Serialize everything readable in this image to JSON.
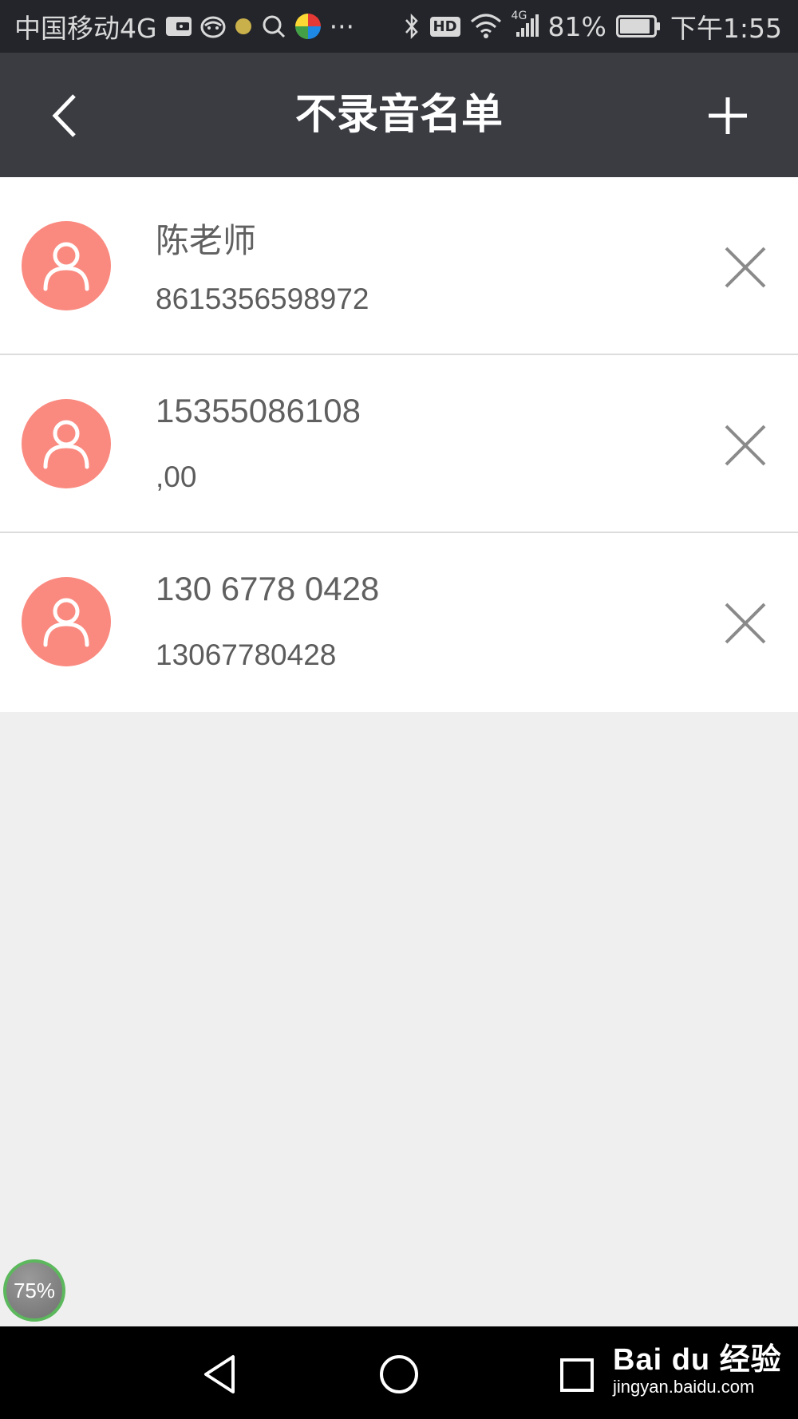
{
  "status_bar": {
    "carrier": "中国移动4G",
    "battery_percent": "81%",
    "time": "下午1:55",
    "network_label": "4G",
    "hd_label": "HD",
    "more_label": "···"
  },
  "header": {
    "title": "不录音名单"
  },
  "contacts": [
    {
      "name": "陈老师",
      "number": "8615356598972"
    },
    {
      "name": "15355086108",
      "number": ",00"
    },
    {
      "name": "130 6778 0428",
      "number": "13067780428"
    }
  ],
  "memory_badge": {
    "label": "75%"
  },
  "watermark": {
    "main": "Bai du 经验",
    "sub": "jingyan.baidu.com"
  },
  "colors": {
    "avatar_bg": "#fa8a80",
    "header_bg": "#3a3c42",
    "status_bg": "#23252b"
  },
  "icons": [
    "back-arrow-icon",
    "add-icon",
    "person-icon",
    "close-icon",
    "nav-back-icon",
    "nav-home-icon",
    "nav-recent-icon"
  ]
}
